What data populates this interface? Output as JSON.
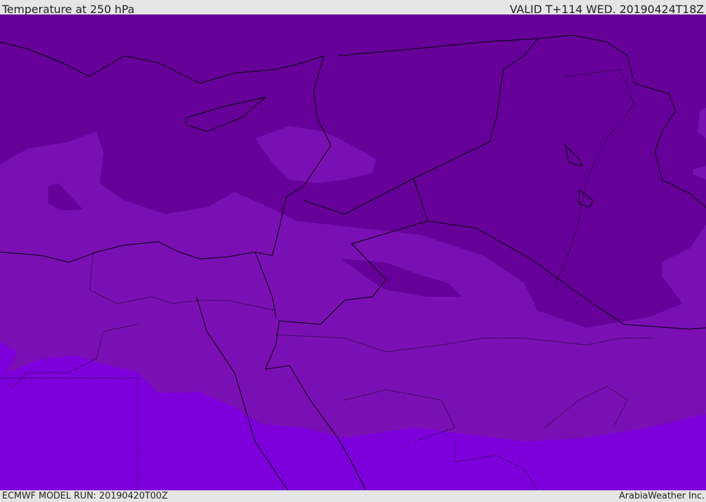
{
  "header": {
    "title": "Temperature at 250 hPa",
    "valid": "VALID T+114 WED. 20190424T18Z"
  },
  "footer": {
    "model_run": "ECMWF MODEL RUN: 20190420T00Z",
    "credit": "ArabiaWeather Inc."
  },
  "colors": {
    "cold_band": "#660099",
    "mid_band": "#7a10b4",
    "warm_band": "#7d00dc",
    "background": "#e5e5e5"
  }
}
